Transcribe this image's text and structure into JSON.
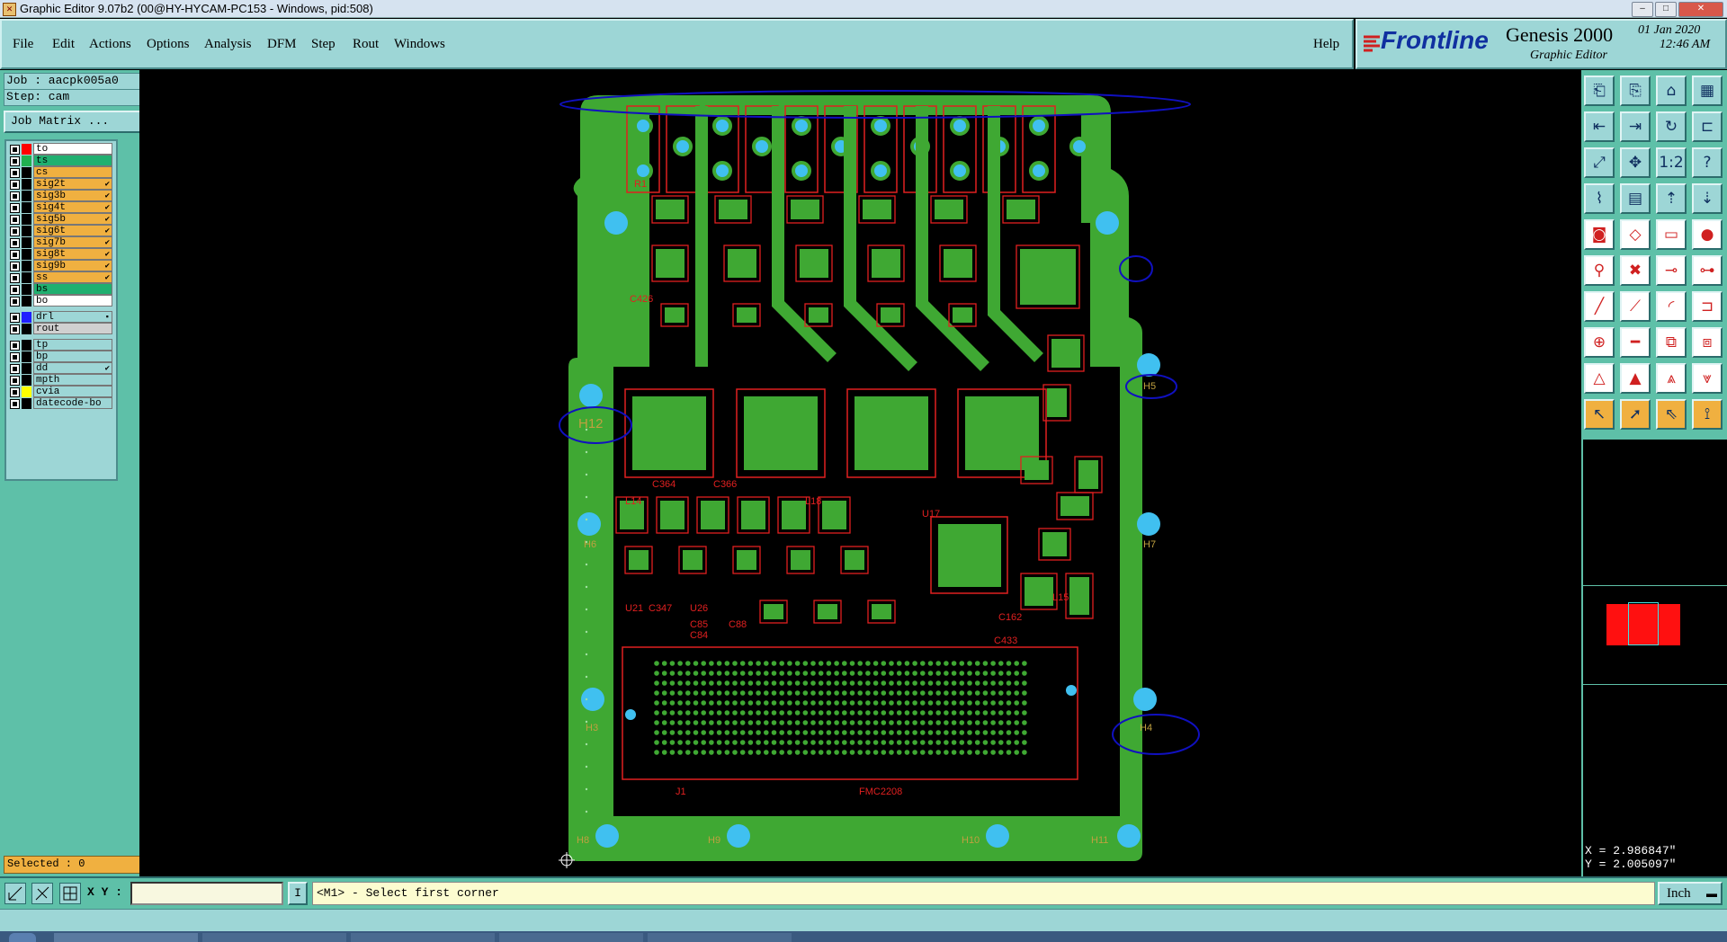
{
  "window": {
    "title": "Graphic Editor 9.07b2 (00@HY-HYCAM-PC153 - Windows, pid:508)",
    "controls": [
      "–",
      "□",
      "✕"
    ]
  },
  "menu": {
    "items": [
      "File",
      "Edit",
      "Actions",
      "Options",
      "Analysis",
      "DFM",
      "Step",
      "Rout",
      "Windows"
    ],
    "help": "Help"
  },
  "brand": {
    "logo": "Frontline",
    "product": "Genesis 2000",
    "subtitle": "Graphic Editor",
    "date": "01 Jan 2020",
    "time": "12:46 AM"
  },
  "job": {
    "job_line": "Job : aacpk005a0",
    "step_line": "Step: cam",
    "matrix_button": "Job Matrix ..."
  },
  "layers": [
    {
      "name": "to",
      "swatch": "#ff0000",
      "bg": "#ffffff",
      "mark": ""
    },
    {
      "name": "ts",
      "swatch": "#20b050",
      "bg": "#20b070",
      "mark": ""
    },
    {
      "name": "cs",
      "swatch": "#000000",
      "bg": "#f0b040",
      "mark": ""
    },
    {
      "name": "sig2t",
      "swatch": "#000000",
      "bg": "#f0b040",
      "mark": "✔"
    },
    {
      "name": "sig3b",
      "swatch": "#000000",
      "bg": "#f0b040",
      "mark": "✔"
    },
    {
      "name": "sig4t",
      "swatch": "#000000",
      "bg": "#f0b040",
      "mark": "✔"
    },
    {
      "name": "sig5b",
      "swatch": "#000000",
      "bg": "#f0b040",
      "mark": "✔"
    },
    {
      "name": "sig6t",
      "swatch": "#000000",
      "bg": "#f0b040",
      "mark": "✔"
    },
    {
      "name": "sig7b",
      "swatch": "#000000",
      "bg": "#f0b040",
      "mark": "✔"
    },
    {
      "name": "sig8t",
      "swatch": "#000000",
      "bg": "#f0b040",
      "mark": "✔"
    },
    {
      "name": "sig9b",
      "swatch": "#000000",
      "bg": "#f0b040",
      "mark": "✔"
    },
    {
      "name": "ss",
      "swatch": "#000000",
      "bg": "#f0b040",
      "mark": "✔"
    },
    {
      "name": "bs",
      "swatch": "#000000",
      "bg": "#20b070",
      "mark": ""
    },
    {
      "name": "bo",
      "swatch": "#000000",
      "bg": "#ffffff",
      "mark": ""
    },
    {
      "name": "drl",
      "swatch": "#2020ff",
      "bg": "#9dd6d6",
      "mark": "▪"
    },
    {
      "name": "rout",
      "swatch": "#000000",
      "bg": "#d0d0d0",
      "mark": ""
    },
    {
      "name": "tp",
      "swatch": "#000000",
      "bg": "#9dd6d6",
      "mark": ""
    },
    {
      "name": "bp",
      "swatch": "#000000",
      "bg": "#9dd6d6",
      "mark": ""
    },
    {
      "name": "dd",
      "swatch": "#000000",
      "bg": "#9dd6d6",
      "mark": "✔"
    },
    {
      "name": "mpth",
      "swatch": "#000000",
      "bg": "#9dd6d6",
      "mark": ""
    },
    {
      "name": "cvia",
      "swatch": "#ffff00",
      "bg": "#9dd6d6",
      "mark": ""
    },
    {
      "name": "datecode-bo",
      "swatch": "#000000",
      "bg": "#9dd6d6",
      "mark": ""
    }
  ],
  "selected": "Selected : 0",
  "board_labels": {
    "holes": [
      "H12",
      "H5",
      "H6",
      "H7",
      "H3",
      "H4",
      "H8",
      "H9",
      "H10",
      "H11"
    ],
    "parts": [
      "C364",
      "C366",
      "L14",
      "L18",
      "U21",
      "C347",
      "U26",
      "U17",
      "C85",
      "C84",
      "C88",
      "L15",
      "C162",
      "C433",
      "J1",
      "FMC2208",
      "C426",
      "R1"
    ]
  },
  "coords": {
    "x": "X = 2.986847\"",
    "y": "Y = 2.005097\""
  },
  "bottom": {
    "xy_label": "X Y :",
    "xy_value": "",
    "cursor_button": "I",
    "prompt": "<M1> - Select first corner",
    "units": "Inch"
  },
  "colors": {
    "board": "#3fa833",
    "copper_outline": "#e02020",
    "pad": "#40c0f0",
    "annotation": "#1010c0",
    "panel": "#5ec0a8",
    "menubar": "#9dd6d6"
  }
}
